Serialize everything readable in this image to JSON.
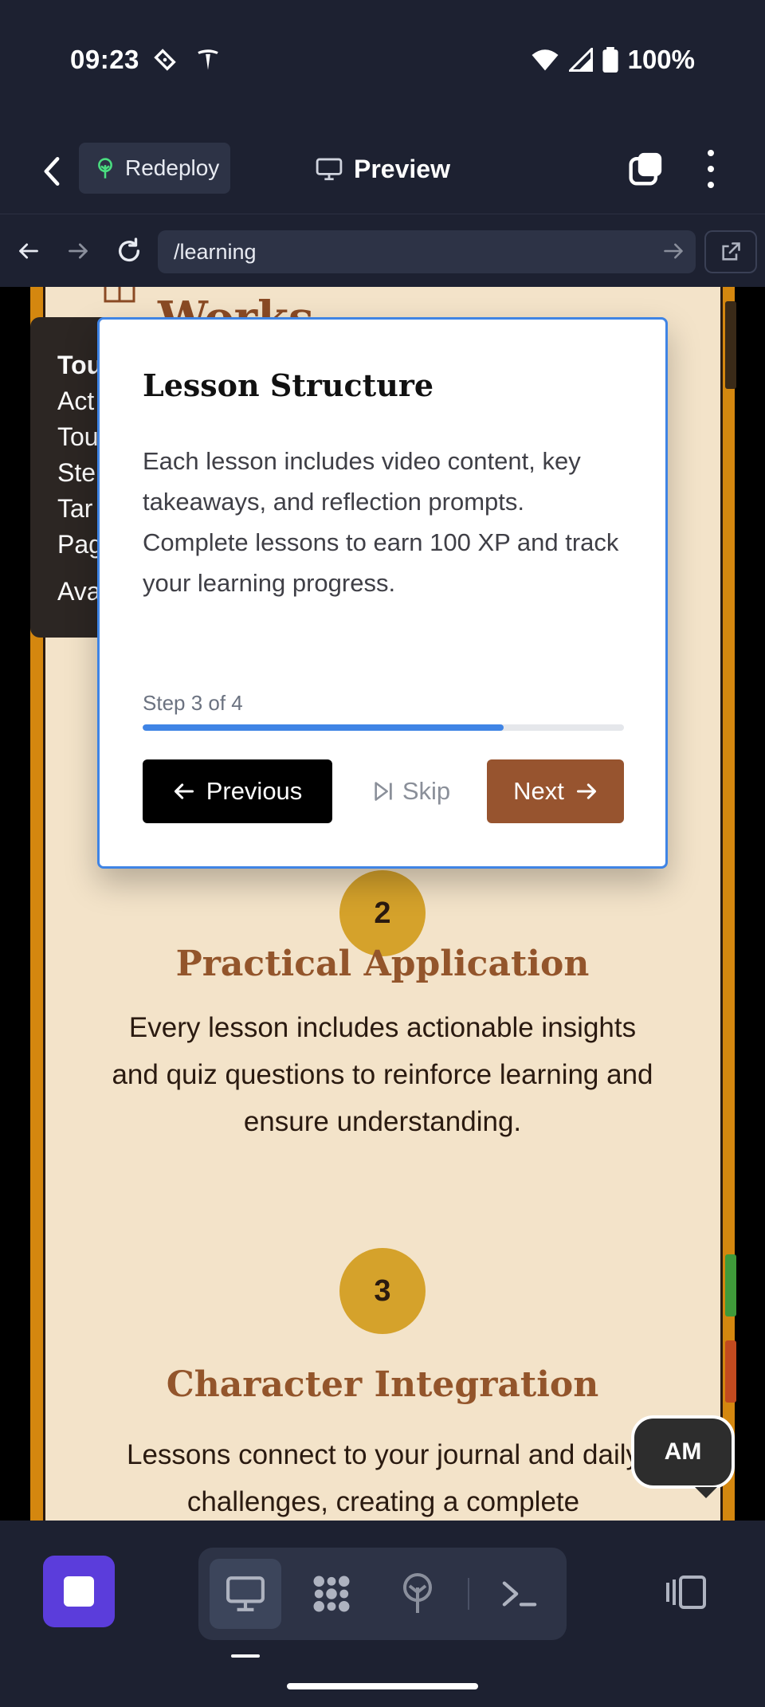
{
  "status_bar": {
    "time": "09:23",
    "battery": "100%"
  },
  "header": {
    "redeploy_label": "Redeploy",
    "preview_label": "Preview"
  },
  "url_bar": {
    "path": "/learning"
  },
  "page": {
    "heading_partial": "Works",
    "sections": [
      {
        "number": "2",
        "title": "Practical Application",
        "body": "Every lesson includes actionable insights and quiz questions to reinforce learning and ensure understanding."
      },
      {
        "number": "3",
        "title": "Character Integration",
        "body": "Lessons connect to your journal and daily challenges, creating a complete"
      }
    ]
  },
  "background_tooltip": {
    "lines": [
      "Tou",
      "Act",
      "Tou",
      "Ste",
      "Tar",
      "Pag"
    ],
    "footer": "Ava"
  },
  "tour_modal": {
    "title": "Lesson Structure",
    "description": "Each lesson includes video content, key takeaways, and reflection prompts. Complete lessons to earn 100 XP and track your learning progress.",
    "step_text": "Step 3 of 4",
    "progress_fraction": 0.75,
    "previous_label": "Previous",
    "skip_label": "Skip",
    "next_label": "Next"
  },
  "avatar": {
    "initials": "AM"
  },
  "colors": {
    "accent_blue": "#3f84e5",
    "brand_brown": "#97542f",
    "gold": "#d5a22b",
    "page_bg": "#f3e3c9",
    "purple": "#5b3ddb"
  },
  "icons": [
    "back-icon",
    "sprout-icon",
    "monitor-icon",
    "square-stack-icon",
    "kebab-icon",
    "arrow-left-icon",
    "arrow-right-icon",
    "reload-icon",
    "external-link-icon",
    "book-icon",
    "skip-icon",
    "stop-icon",
    "desktop-icon",
    "dots-grid-icon",
    "antenna-icon",
    "terminal-icon",
    "panel-icon"
  ]
}
